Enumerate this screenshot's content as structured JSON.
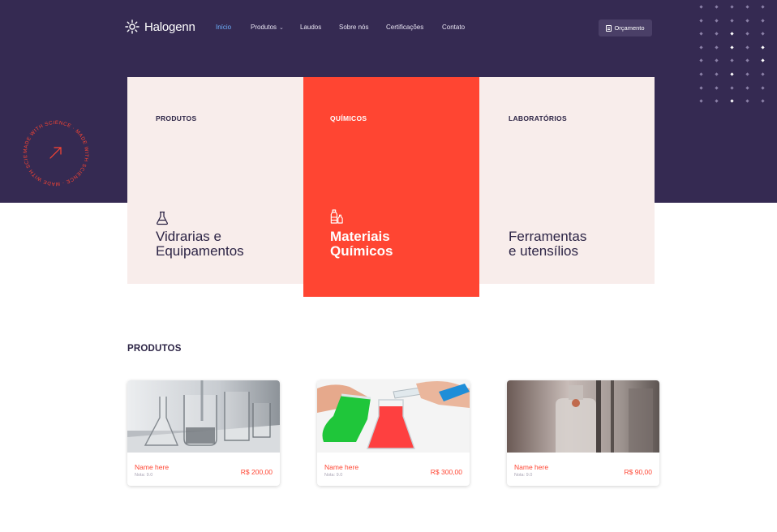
{
  "header": {
    "brand": "Halogenn",
    "nav": [
      {
        "label": "Início",
        "active": true
      },
      {
        "label": "Produtos",
        "dropdown": true
      },
      {
        "label": "Laudos"
      },
      {
        "label": "Sobre nós"
      },
      {
        "label": "Certificações"
      },
      {
        "label": "Contato"
      }
    ],
    "quote_button": "Orçamento"
  },
  "badge": {
    "text": "MADE WITH SCIENCE · MADE WITH SCIENCE · MADE WITH SCIENCE ·",
    "icon": "arrow-up-right-icon"
  },
  "categories": [
    {
      "label": "PRODUTOS",
      "title_line1": "Vidrarias e",
      "title_line2": "Equipamentos",
      "icon": "flask-icon"
    },
    {
      "label": "QUÍMICOS",
      "title_line1": "Materiais",
      "title_line2": "Químicos",
      "icon": "bottles-icon"
    },
    {
      "label": "LABORATÓRIOS",
      "title_line1": "Ferramentas",
      "title_line2": "e utensílios",
      "icon": ""
    }
  ],
  "products_section": {
    "title": "PRODUTOS",
    "items": [
      {
        "name": "Name here",
        "rating": "Nota: 9.0",
        "price": "R$ 200,00"
      },
      {
        "name": "Name here",
        "rating": "Nota: 9.0",
        "price": "R$ 300,00"
      },
      {
        "name": "Name here",
        "rating": "Nota: 9.0",
        "price": "R$ 90,00"
      }
    ]
  },
  "colors": {
    "primary_dark": "#352a52",
    "accent": "#ff4532",
    "card_light": "#f8edeb",
    "nav_active": "#6fb2ff"
  }
}
